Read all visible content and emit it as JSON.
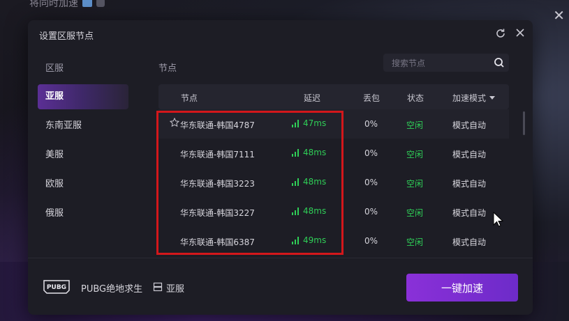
{
  "background": {
    "title": "将同时加速"
  },
  "dialog": {
    "title": "设置区服节点",
    "refresh_icon": "refresh-icon",
    "close_icon": "close-icon"
  },
  "regions": {
    "header": "区服",
    "items": [
      {
        "label": "亚服",
        "active": true
      },
      {
        "label": "东南亚服",
        "active": false
      },
      {
        "label": "美服",
        "active": false
      },
      {
        "label": "欧服",
        "active": false
      },
      {
        "label": "俄服",
        "active": false
      }
    ]
  },
  "nodes": {
    "header": "节点",
    "search_placeholder": "搜索节点",
    "columns": {
      "node": "节点",
      "latency": "延迟",
      "loss": "丢包",
      "status": "状态",
      "mode": "加速模式"
    },
    "rows": [
      {
        "name": "华东联通-韩国4787",
        "latency": "47ms",
        "loss": "0%",
        "status": "空闲",
        "mode": "模式自动",
        "favorite_icon": "star-outline-icon"
      },
      {
        "name": "华东联通-韩国7111",
        "latency": "48ms",
        "loss": "0%",
        "status": "空闲",
        "mode": "模式自动"
      },
      {
        "name": "华东联通-韩国3223",
        "latency": "48ms",
        "loss": "0%",
        "status": "空闲",
        "mode": "模式自动"
      },
      {
        "name": "华东联通-韩国3227",
        "latency": "48ms",
        "loss": "0%",
        "status": "空闲",
        "mode": "模式自动"
      },
      {
        "name": "华东联通-韩国6387",
        "latency": "49ms",
        "loss": "0%",
        "status": "空闲",
        "mode": "模式自动"
      }
    ]
  },
  "footer": {
    "logo": "PUBG",
    "game_name": "PUBG绝地求生",
    "server": "亚服",
    "accelerate_button": "一键加速"
  },
  "colors": {
    "accent_purple": "#8a30d8",
    "status_green": "#2fcf57",
    "highlight_red": "#d3171b",
    "dialog_bg": "#1d1d25"
  }
}
